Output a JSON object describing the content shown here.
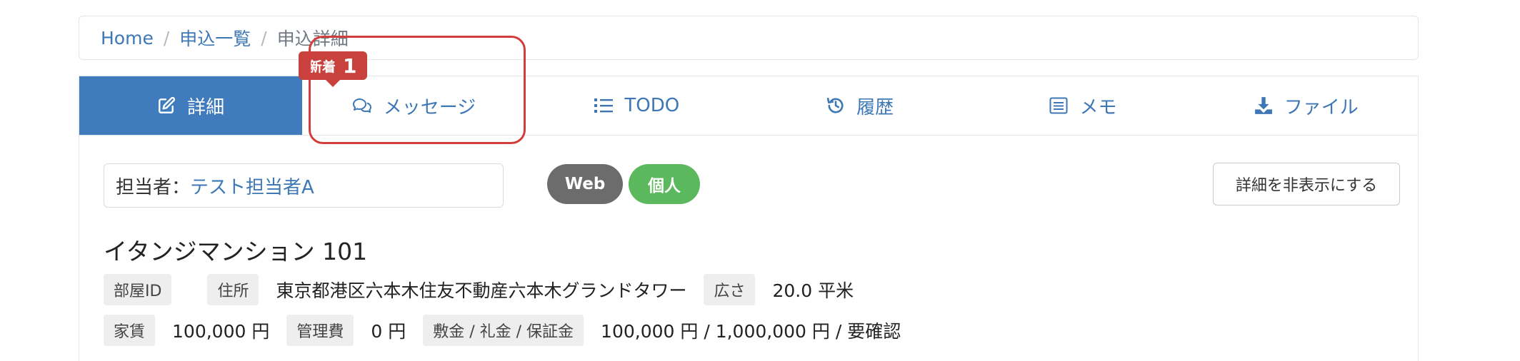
{
  "breadcrumb": {
    "home": "Home",
    "list": "申込一覧",
    "current": "申込詳細",
    "sep": "/"
  },
  "tabs": [
    {
      "label": "詳細",
      "icon": "edit-icon",
      "active": true
    },
    {
      "label": "メッセージ",
      "icon": "chat-icon",
      "active": false
    },
    {
      "label": "TODO",
      "icon": "list-icon",
      "active": false
    },
    {
      "label": "履歴",
      "icon": "history-icon",
      "active": false
    },
    {
      "label": "メモ",
      "icon": "memo-icon",
      "active": false
    },
    {
      "label": "ファイル",
      "icon": "download-icon",
      "active": false
    }
  ],
  "new_badge": {
    "label": "新着",
    "count": "1"
  },
  "assignee": {
    "label": "担当者：",
    "value": "テスト担当者A"
  },
  "tags": {
    "web": "Web",
    "kojin": "個人"
  },
  "hide_button": "詳細を非表示にする",
  "property": {
    "name": "イタンジマンション 101",
    "room_id_label": "部屋ID",
    "address_label": "住所",
    "address": "東京都港区六本木住友不動産六本木グランドタワー",
    "area_label": "広さ",
    "area": "20.0 平米",
    "rent_label": "家賃",
    "rent": "100,000 円",
    "fee_label": "管理費",
    "fee": "0 円",
    "deposit_label": "敷金 / 礼金 / 保証金",
    "deposit": "100,000 円 / 1,000,000 円 / 要確認"
  },
  "colors": {
    "accent": "#3f7bbd",
    "badge": "#c9413c",
    "web_tag": "#6c6c6c",
    "kojin_tag": "#5cb85c"
  }
}
